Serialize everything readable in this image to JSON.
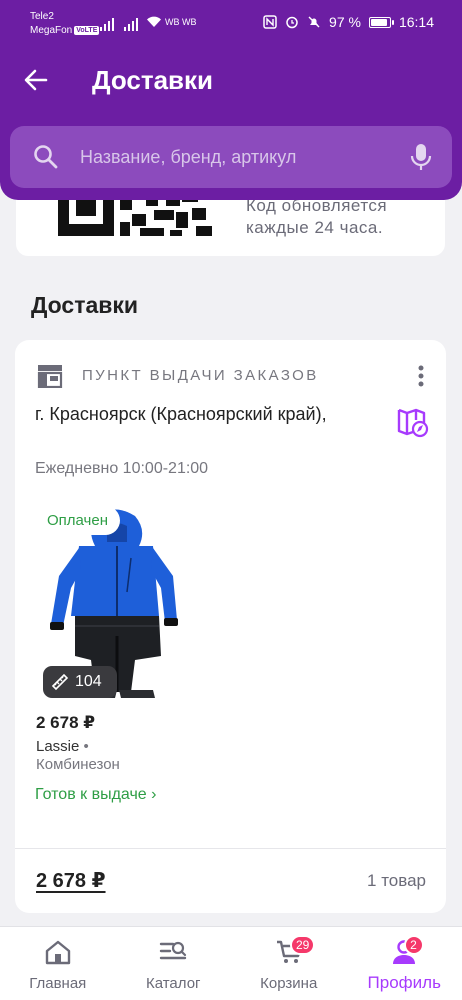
{
  "status_bar": {
    "carrier1": "Tele2",
    "carrier2": "MegaFon",
    "volte": "VoLTE",
    "wifi_label": "WB WB",
    "battery": "97 %",
    "time": "16:14"
  },
  "header": {
    "title": "Доставки",
    "search_placeholder": "Название, бренд, артикул"
  },
  "qr_card": {
    "note_line1": "Код обновляется",
    "note_line2": "каждые 24 часа."
  },
  "section_title": "Доставки",
  "delivery": {
    "pickup_label": "ПУНКТ ВЫДАЧИ ЗАКАЗОВ",
    "address": "г. Красноярск (Красноярский край),",
    "hours": "Ежедневно 10:00-21:00",
    "product": {
      "status": "Оплачен",
      "size": "104",
      "price": "2 678 ₽",
      "brand": "Lassie",
      "brand_sep": "•",
      "name": "Комбинезон",
      "ready_link": "Готов к выдаче ›"
    },
    "total": "2 678 ₽",
    "count": "1 товар"
  },
  "bottom_nav": {
    "items": [
      {
        "label": "Главная",
        "icon": "home-icon"
      },
      {
        "label": "Каталог",
        "icon": "catalog-icon"
      },
      {
        "label": "Корзина",
        "icon": "cart-icon",
        "badge": "29"
      },
      {
        "label": "Профиль",
        "icon": "profile-icon",
        "badge": "2",
        "active": true
      }
    ]
  },
  "colors": {
    "brand": "#6c1ea3",
    "accent": "#a73afd",
    "success": "#2e9e45",
    "badge": "#f5386a",
    "product_blue": "#1e5fd9"
  }
}
